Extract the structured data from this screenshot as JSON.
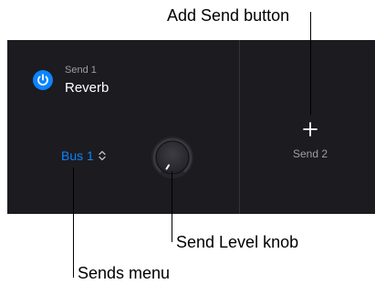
{
  "send1": {
    "title": "Send 1",
    "effect": "Reverb",
    "power_icon": "power-icon",
    "bus": "Bus 1",
    "chevron_icon": "chevron-updown-icon"
  },
  "send2": {
    "label": "Send 2",
    "add_icon": "plus-icon"
  },
  "callouts": {
    "add_send": "Add Send button",
    "send_level": "Send Level knob",
    "sends_menu": "Sends menu"
  },
  "colors": {
    "panel_background": "#1c1b20",
    "accent_blue": "#0a84ff",
    "secondary_text": "#9e9da5",
    "primary_text": "#ffffff"
  }
}
